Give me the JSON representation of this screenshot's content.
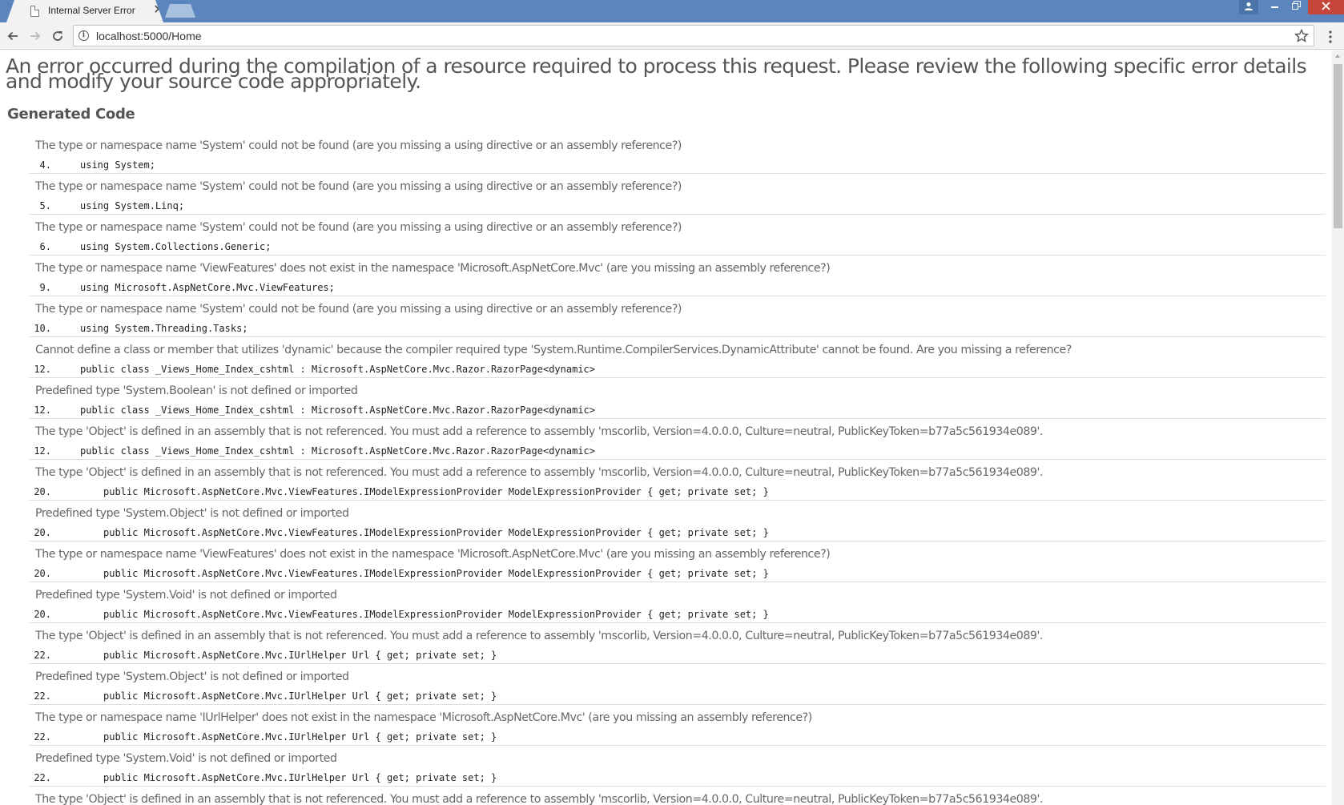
{
  "browser": {
    "tab_title": "Internal Server Error",
    "url": "localhost:5000/Home"
  },
  "page": {
    "headline": "An error occurred during the compilation of a resource required to process this request. Please review the following specific error details and modify your source code appropriately.",
    "section_title": "Generated Code",
    "errors": [
      {
        "message": "The type or namespace name 'System' could not be found (are you missing a using directive or an assembly reference?)",
        "line": "4.",
        "code": "using System;"
      },
      {
        "message": "The type or namespace name 'System' could not be found (are you missing a using directive or an assembly reference?)",
        "line": "5.",
        "code": "using System.Linq;"
      },
      {
        "message": "The type or namespace name 'System' could not be found (are you missing a using directive or an assembly reference?)",
        "line": "6.",
        "code": "using System.Collections.Generic;"
      },
      {
        "message": "The type or namespace name 'ViewFeatures' does not exist in the namespace 'Microsoft.AspNetCore.Mvc' (are you missing an assembly reference?)",
        "line": "9.",
        "code": "using Microsoft.AspNetCore.Mvc.ViewFeatures;"
      },
      {
        "message": "The type or namespace name 'System' could not be found (are you missing a using directive or an assembly reference?)",
        "line": "10.",
        "code": "using System.Threading.Tasks;"
      },
      {
        "message": "Cannot define a class or member that utilizes 'dynamic' because the compiler required type 'System.Runtime.CompilerServices.DynamicAttribute' cannot be found. Are you missing a reference?",
        "line": "12.",
        "code": "public class _Views_Home_Index_cshtml : Microsoft.AspNetCore.Mvc.Razor.RazorPage<dynamic>"
      },
      {
        "message": "Predefined type 'System.Boolean' is not defined or imported",
        "line": "12.",
        "code": "public class _Views_Home_Index_cshtml : Microsoft.AspNetCore.Mvc.Razor.RazorPage<dynamic>"
      },
      {
        "message": "The type 'Object' is defined in an assembly that is not referenced. You must add a reference to assembly 'mscorlib, Version=4.0.0.0, Culture=neutral, PublicKeyToken=b77a5c561934e089'.",
        "line": "12.",
        "code": "public class _Views_Home_Index_cshtml : Microsoft.AspNetCore.Mvc.Razor.RazorPage<dynamic>"
      },
      {
        "message": "The type 'Object' is defined in an assembly that is not referenced. You must add a reference to assembly 'mscorlib, Version=4.0.0.0, Culture=neutral, PublicKeyToken=b77a5c561934e089'.",
        "line": "20.",
        "code": "public Microsoft.AspNetCore.Mvc.ViewFeatures.IModelExpressionProvider ModelExpressionProvider { get; private set; }"
      },
      {
        "message": "Predefined type 'System.Object' is not defined or imported",
        "line": "20.",
        "code": "public Microsoft.AspNetCore.Mvc.ViewFeatures.IModelExpressionProvider ModelExpressionProvider { get; private set; }"
      },
      {
        "message": "The type or namespace name 'ViewFeatures' does not exist in the namespace 'Microsoft.AspNetCore.Mvc' (are you missing an assembly reference?)",
        "line": "20.",
        "code": "public Microsoft.AspNetCore.Mvc.ViewFeatures.IModelExpressionProvider ModelExpressionProvider { get; private set; }"
      },
      {
        "message": "Predefined type 'System.Void' is not defined or imported",
        "line": "20.",
        "code": "public Microsoft.AspNetCore.Mvc.ViewFeatures.IModelExpressionProvider ModelExpressionProvider { get; private set; }"
      },
      {
        "message": "The type 'Object' is defined in an assembly that is not referenced. You must add a reference to assembly 'mscorlib, Version=4.0.0.0, Culture=neutral, PublicKeyToken=b77a5c561934e089'.",
        "line": "22.",
        "code": "public Microsoft.AspNetCore.Mvc.IUrlHelper Url { get; private set; }"
      },
      {
        "message": "Predefined type 'System.Object' is not defined or imported",
        "line": "22.",
        "code": "public Microsoft.AspNetCore.Mvc.IUrlHelper Url { get; private set; }"
      },
      {
        "message": "The type or namespace name 'IUrlHelper' does not exist in the namespace 'Microsoft.AspNetCore.Mvc' (are you missing an assembly reference?)",
        "line": "22.",
        "code": "public Microsoft.AspNetCore.Mvc.IUrlHelper Url { get; private set; }"
      },
      {
        "message": "Predefined type 'System.Void' is not defined or imported",
        "line": "22.",
        "code": "public Microsoft.AspNetCore.Mvc.IUrlHelper Url { get; private set; }"
      },
      {
        "message": "The type 'Object' is defined in an assembly that is not referenced. You must add a reference to assembly 'mscorlib, Version=4.0.0.0, Culture=neutral, PublicKeyToken=b77a5c561934e089'.",
        "line": "",
        "code": ""
      }
    ]
  },
  "colors": {
    "titlebar": "#5b86bd",
    "close_button": "#c7463b",
    "text_gray": "#666666"
  }
}
